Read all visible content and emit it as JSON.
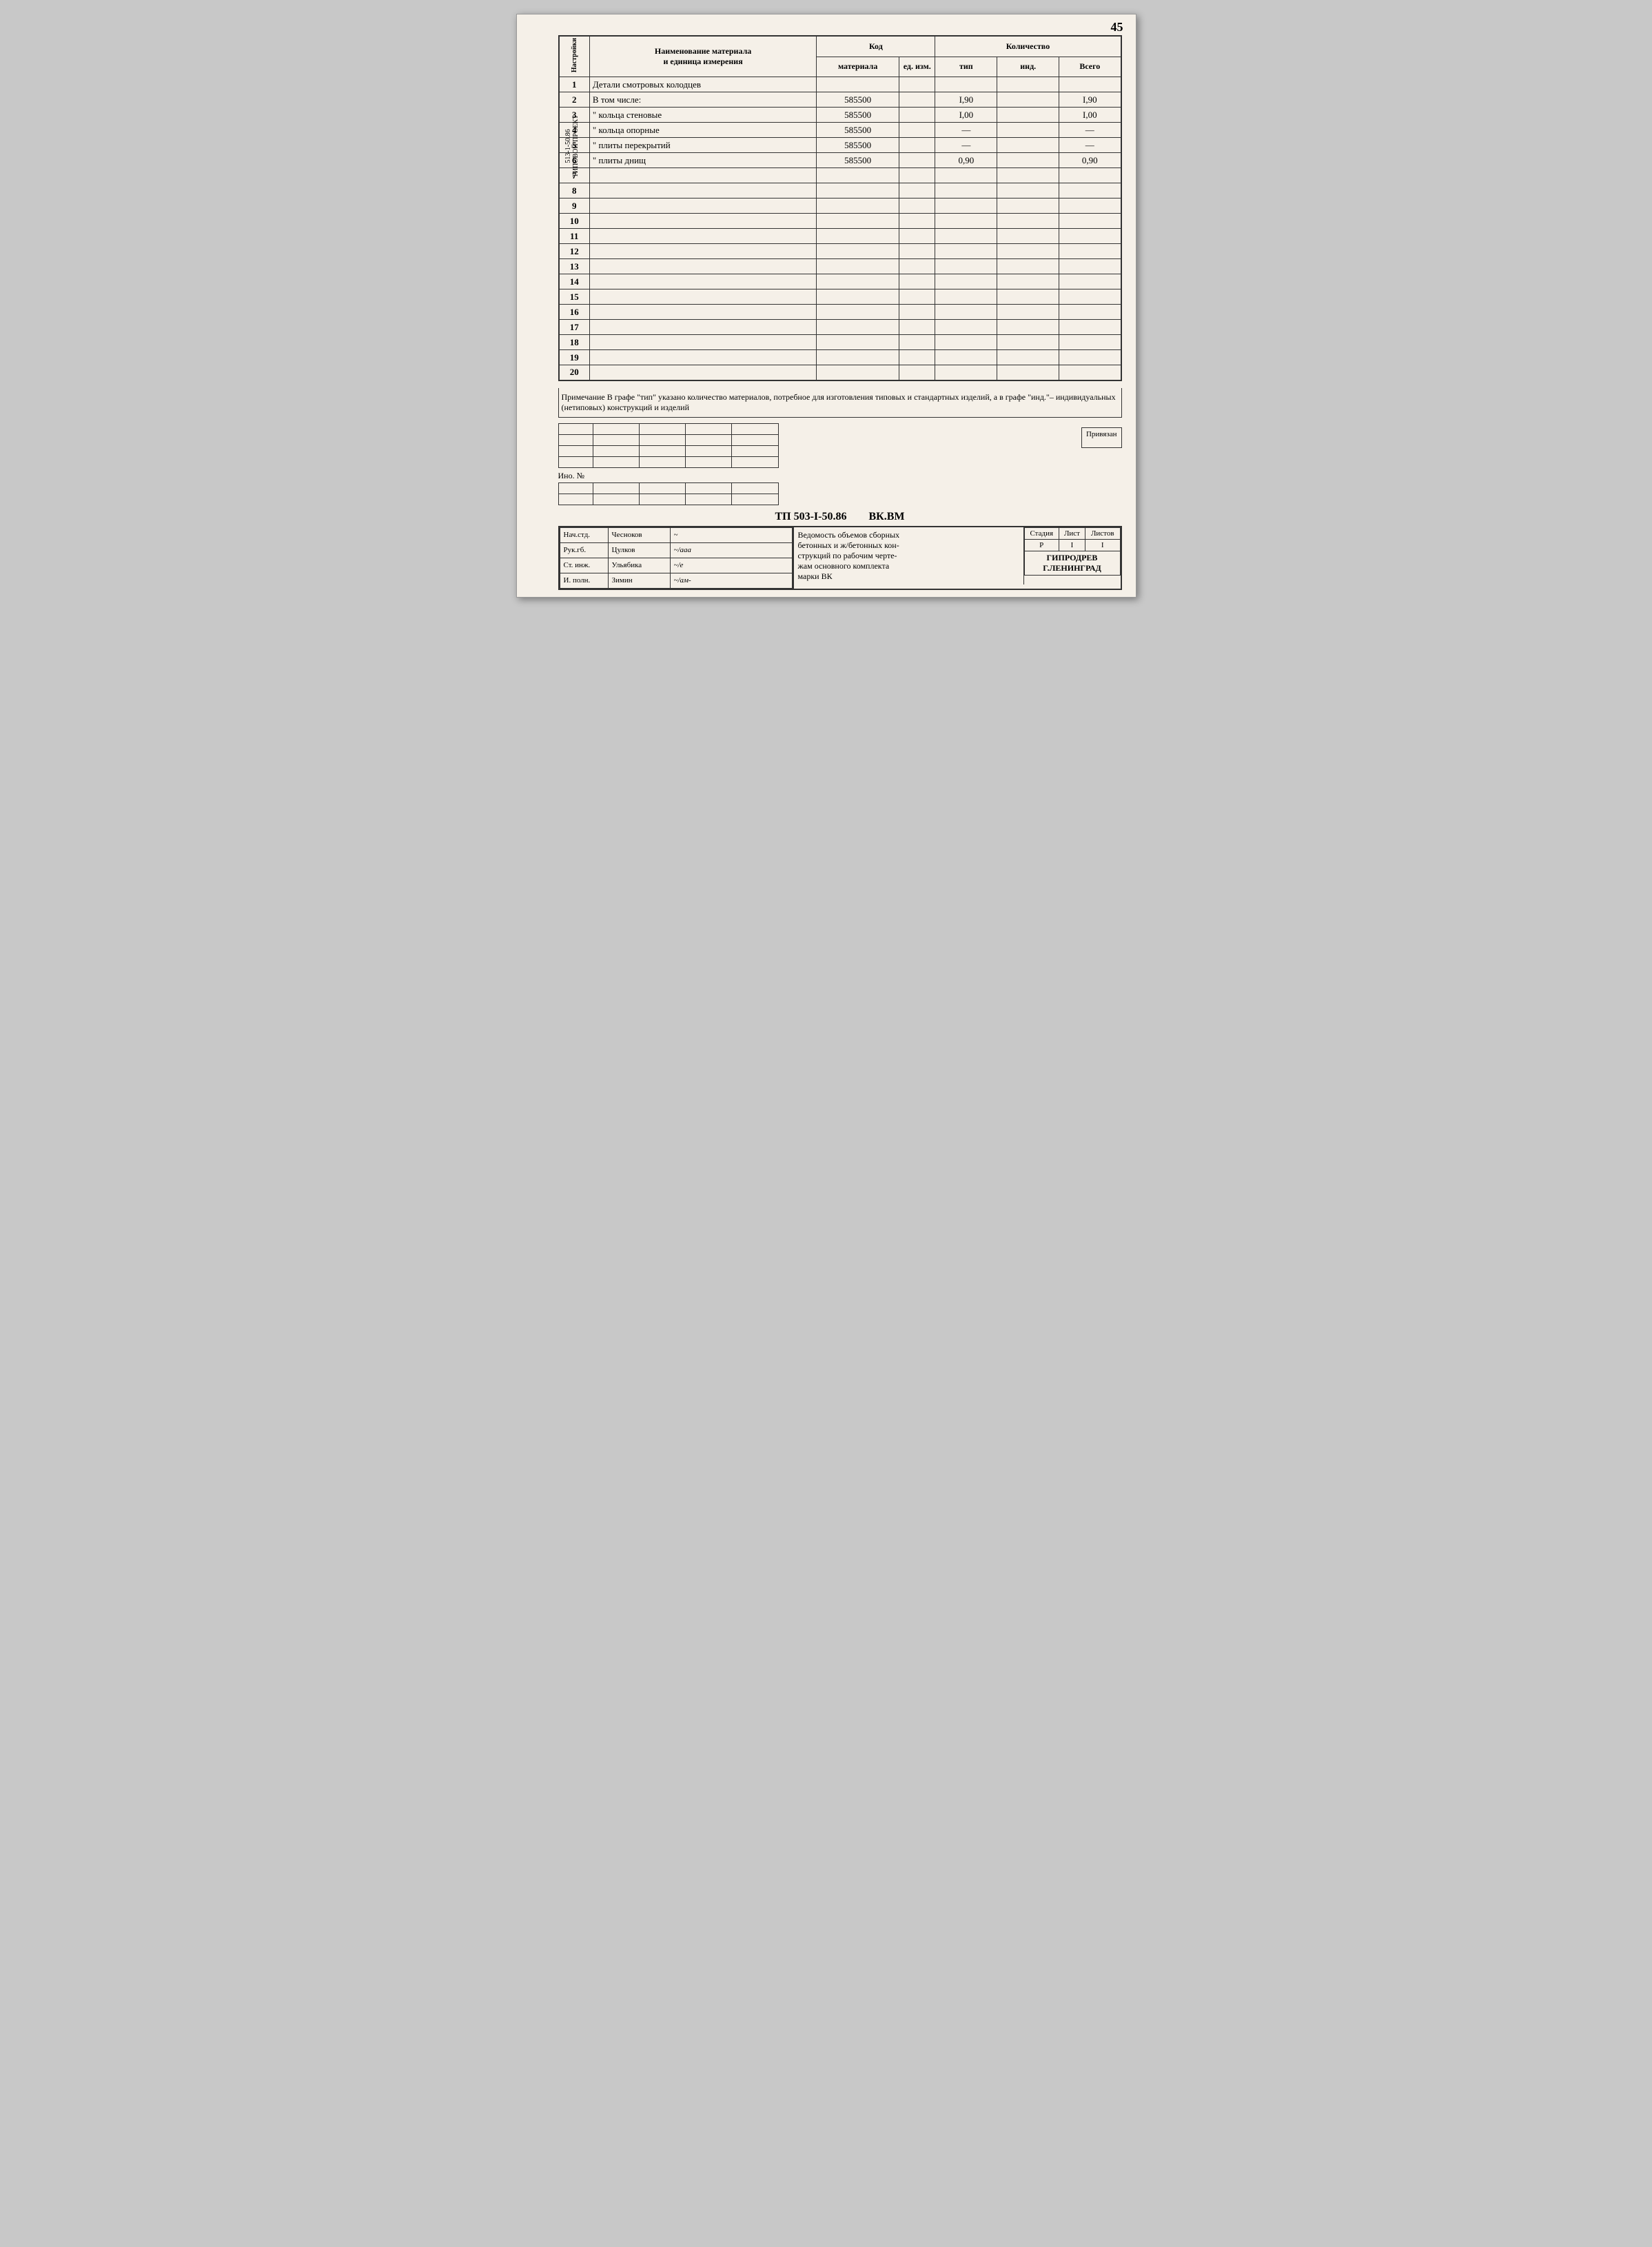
{
  "page": {
    "number": "45",
    "side_label_top": "513-1-50.86",
    "side_label_bottom": "ТИПОВОЙ ПРОЕКТ"
  },
  "header": {
    "col1": "Настройки",
    "col2_line1": "Наименование материала",
    "col2_line2": "и единица измерения",
    "col3": "Код",
    "col4": "Количество",
    "subheader": {
      "materiala": "материала",
      "ed_izm": "ед. изм.",
      "tip": "тип",
      "ind": "инд.",
      "vsego": "Всего"
    }
  },
  "rows": [
    {
      "num": "1",
      "name": "Детали смотровых колодцев",
      "code": "",
      "ed_izm": "",
      "tip": "",
      "ind": "",
      "vsego": ""
    },
    {
      "num": "2",
      "name": "В том числе:",
      "code": "585500",
      "ed_izm": "",
      "tip": "I,90",
      "ind": "",
      "vsego": "I,90"
    },
    {
      "num": "3",
      "name": "\"    кольца стеновые",
      "code": "585500",
      "ed_izm": "",
      "tip": "I,00",
      "ind": "",
      "vsego": "I,00"
    },
    {
      "num": "4",
      "name": "\"    кольца опорные",
      "code": "585500",
      "ed_izm": "",
      "tip": "—",
      "ind": "",
      "vsego": "—"
    },
    {
      "num": "5",
      "name": "\"    плиты перекрытий",
      "code": "585500",
      "ed_izm": "",
      "tip": "—",
      "ind": "",
      "vsego": "—"
    },
    {
      "num": "6",
      "name": "\"    плиты днищ",
      "code": "585500",
      "ed_izm": "",
      "tip": "0,90",
      "ind": "",
      "vsego": "0,90"
    },
    {
      "num": "7",
      "name": "",
      "code": "",
      "ed_izm": "",
      "tip": "",
      "ind": "",
      "vsego": ""
    },
    {
      "num": "8",
      "name": "",
      "code": "",
      "ed_izm": "",
      "tip": "",
      "ind": "",
      "vsego": ""
    },
    {
      "num": "9",
      "name": "",
      "code": "",
      "ed_izm": "",
      "tip": "",
      "ind": "",
      "vsego": ""
    },
    {
      "num": "10",
      "name": "",
      "code": "",
      "ed_izm": "",
      "tip": "",
      "ind": "",
      "vsego": ""
    },
    {
      "num": "11",
      "name": "",
      "code": "",
      "ed_izm": "",
      "tip": "",
      "ind": "",
      "vsego": ""
    },
    {
      "num": "12",
      "name": "",
      "code": "",
      "ed_izm": "",
      "tip": "",
      "ind": "",
      "vsego": ""
    },
    {
      "num": "13",
      "name": "",
      "code": "",
      "ed_izm": "",
      "tip": "",
      "ind": "",
      "vsego": ""
    },
    {
      "num": "14",
      "name": "",
      "code": "",
      "ed_izm": "",
      "tip": "",
      "ind": "",
      "vsego": ""
    },
    {
      "num": "15",
      "name": "",
      "code": "",
      "ed_izm": "",
      "tip": "",
      "ind": "",
      "vsego": ""
    },
    {
      "num": "16",
      "name": "",
      "code": "",
      "ed_izm": "",
      "tip": "",
      "ind": "",
      "vsego": ""
    },
    {
      "num": "17",
      "name": "",
      "code": "",
      "ed_izm": "",
      "tip": "",
      "ind": "",
      "vsego": ""
    },
    {
      "num": "18",
      "name": "",
      "code": "",
      "ed_izm": "",
      "tip": "",
      "ind": "",
      "vsego": ""
    },
    {
      "num": "19",
      "name": "",
      "code": "",
      "ed_izm": "",
      "tip": "",
      "ind": "",
      "vsego": ""
    },
    {
      "num": "20",
      "name": "",
      "code": "",
      "ed_izm": "",
      "tip": "",
      "ind": "",
      "vsego": ""
    }
  ],
  "note": {
    "text": "Примечание В графе \"тип\" указано количество материалов, потребное для изготовления типовых и стандартных изделий, а в графе \"инд.\"– индивидуальных (нетиповых) конструкций и изделий"
  },
  "privyazan_label": "Привязан",
  "ino_no_label": "Ино. №",
  "drawing_code": "ТП    503-I-50.86",
  "drawing_code2": "ВК.ВМ",
  "stamp": {
    "roles": [
      {
        "role": "Нач.стд.",
        "name": "Чесноков",
        "sign": "~"
      },
      {
        "role": "Рук.гб.",
        "name": "Цулков",
        "sign": "~/ааа"
      },
      {
        "role": "Ст. инж.",
        "name": "Ульябика",
        "sign": "~/е"
      },
      {
        "role": "И. полн.",
        "name": "Зимин",
        "sign": "~/ам-"
      }
    ],
    "title_line1": "Ведомость объемов сборных",
    "title_line2": "бетонных и ж/бетонных кон-",
    "title_line3": "струкций по рабочим черте-",
    "title_line4": "жам основного комплекта",
    "title_line5": "марки ВК",
    "stadiya_label": "Стадия",
    "list_label": "Лист",
    "listov_label": "Листов",
    "stadiya_val": "Р",
    "list_val": "I",
    "listov_val": "I",
    "org_line1": "ГИПРОДРЕВ",
    "org_line2": "Г.ЛЕНИНГРАД"
  }
}
